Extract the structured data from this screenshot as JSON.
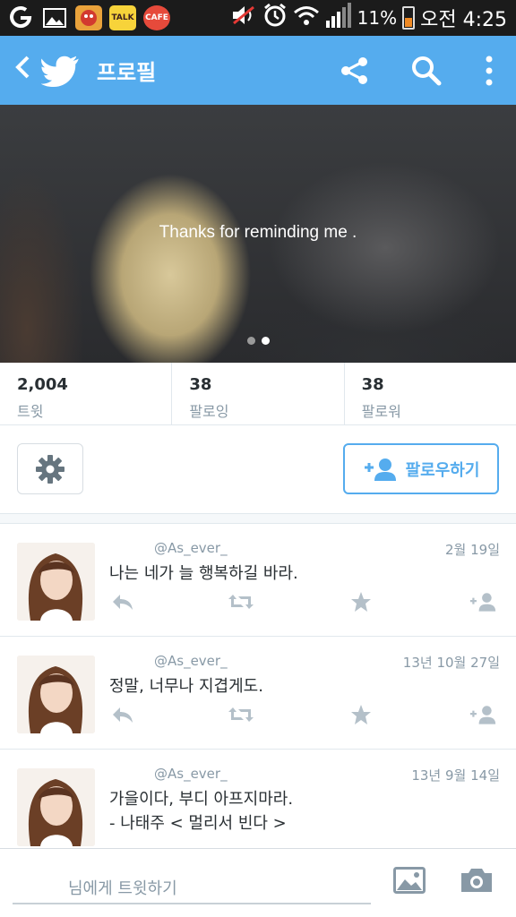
{
  "status_bar": {
    "apps": [
      {
        "icon": "smart-launcher-icon",
        "label": ""
      },
      {
        "icon": "gallery-icon",
        "label": ""
      },
      {
        "icon": "game-app-icon",
        "label": ""
      },
      {
        "icon": "kakaotalk-icon",
        "label": "TALK"
      },
      {
        "icon": "cafe-app-icon",
        "label": "CAFE"
      }
    ],
    "battery": "11%",
    "time": "오전 4:25",
    "icons": [
      "mute-icon",
      "alarm-icon",
      "wifi-icon",
      "signal-icon",
      "battery-icon"
    ]
  },
  "app_bar": {
    "title": "프로필",
    "color": "#55acee",
    "actions": [
      "share-icon",
      "search-icon",
      "more-icon"
    ]
  },
  "profile": {
    "bio": "Thanks for reminding me .",
    "page_indicator": {
      "count": 2,
      "active_index": 1
    },
    "stats": [
      {
        "value": "2,004",
        "label": "트윗"
      },
      {
        "value": "38",
        "label": "팔로잉"
      },
      {
        "value": "38",
        "label": "팔로워"
      }
    ],
    "follow_label": "팔로우하기"
  },
  "tweets": [
    {
      "handle": "@As_ever_",
      "time": "2월 19일",
      "text": "나는 네가 늘 행복하길 바라."
    },
    {
      "handle": "@As_ever_",
      "time": "13년 10월 27일",
      "text": "정말, 너무나 지겹게도."
    },
    {
      "handle": "@As_ever_",
      "time": "13년 9월 14일",
      "text": "가을이다, 부디 아프지마라.\n- 나태주 < 멀리서 빈다 >"
    }
  ],
  "composer": {
    "placeholder": "님에게 트윗하기"
  }
}
